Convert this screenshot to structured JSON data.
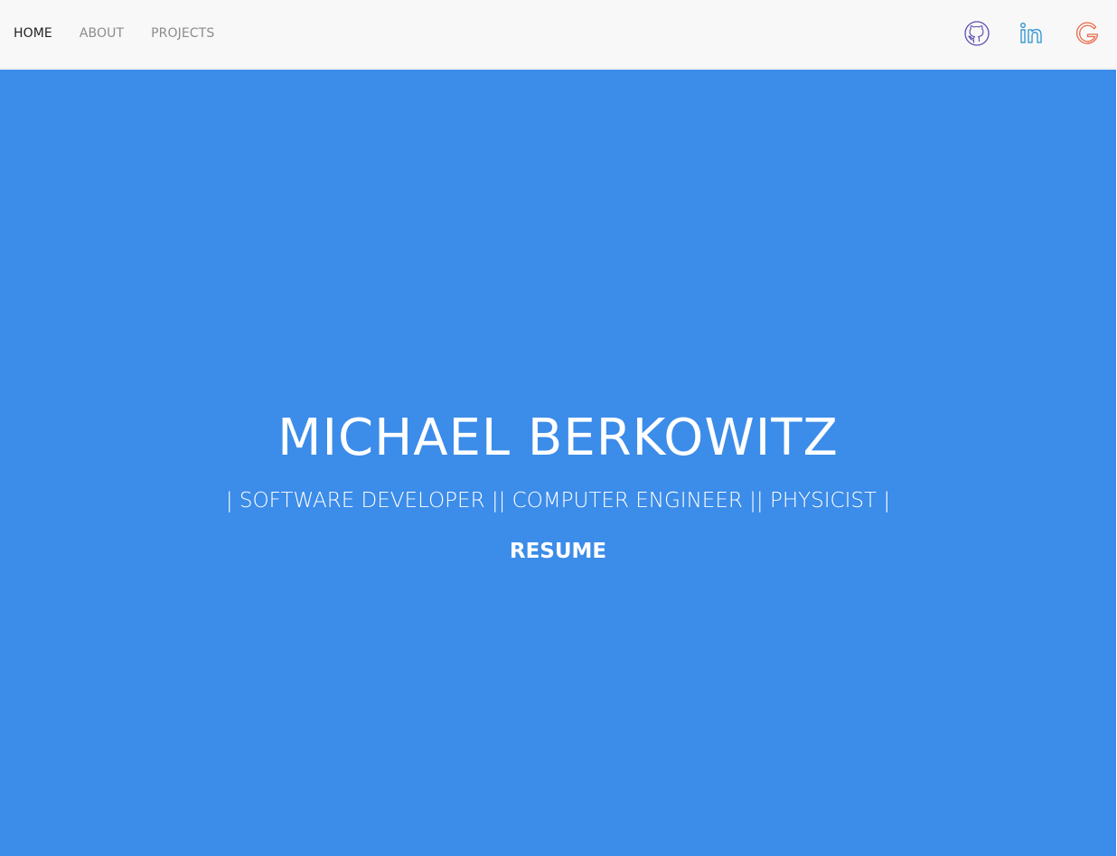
{
  "nav": {
    "links": [
      {
        "label": "HOME",
        "active": true
      },
      {
        "label": "ABOUT",
        "active": false
      },
      {
        "label": "PROJECTS",
        "active": false
      }
    ]
  },
  "social": {
    "icons": [
      {
        "name": "github-icon",
        "color": "#5a4fb1"
      },
      {
        "name": "linkedin-icon",
        "color": "#2a8fd0"
      },
      {
        "name": "google-icon",
        "color": "#ea6a4a"
      }
    ]
  },
  "hero": {
    "name": "MICHAEL BERKOWITZ",
    "tagline": "| SOFTWARE DEVELOPER || COMPUTER ENGINEER || PHYSICIST |",
    "resume_label": "RESUME",
    "background": "#3c8ce9"
  }
}
